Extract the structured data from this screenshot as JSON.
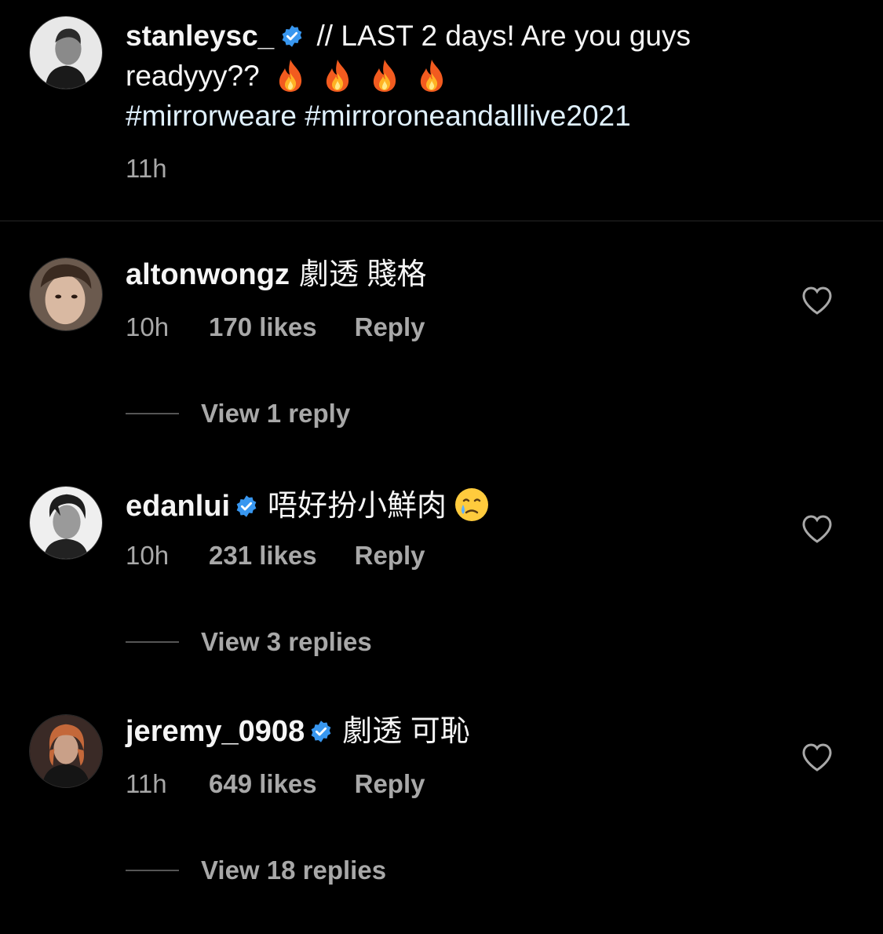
{
  "caption": {
    "username": "stanleysc_",
    "text_line1": " // LAST 2 days! Are you guys",
    "text_line2": "readyyy?? ",
    "fire_emoji_count": 4,
    "hashtags": [
      "#mirrorweare",
      "#mirroroneandalllive2021"
    ],
    "time": "11h",
    "avatar_icon": "portrait-avatar-icon"
  },
  "comments": [
    {
      "username": "altonwongz",
      "verified": false,
      "text": "劇透 賤格",
      "emoji": "",
      "time": "10h",
      "likes": "170 likes",
      "reply_label": "Reply",
      "view_replies": "View 1 reply"
    },
    {
      "username": "edanlui",
      "verified": true,
      "text": "唔好扮小鮮肉",
      "emoji": "face-holding-back-tears",
      "time": "10h",
      "likes": "231 likes",
      "reply_label": "Reply",
      "view_replies": "View 3 replies"
    },
    {
      "username": "jeremy_0908",
      "verified": true,
      "text": "劇透 可恥",
      "emoji": "",
      "time": "11h",
      "likes": "649 likes",
      "reply_label": "Reply",
      "view_replies": "View 18 replies"
    }
  ],
  "colors": {
    "background": "#000000",
    "text": "#f5f5f5",
    "secondary": "#a8a8a8",
    "hashtag": "#e0f1ff",
    "verified": "#3897f0",
    "divider": "#262626"
  }
}
